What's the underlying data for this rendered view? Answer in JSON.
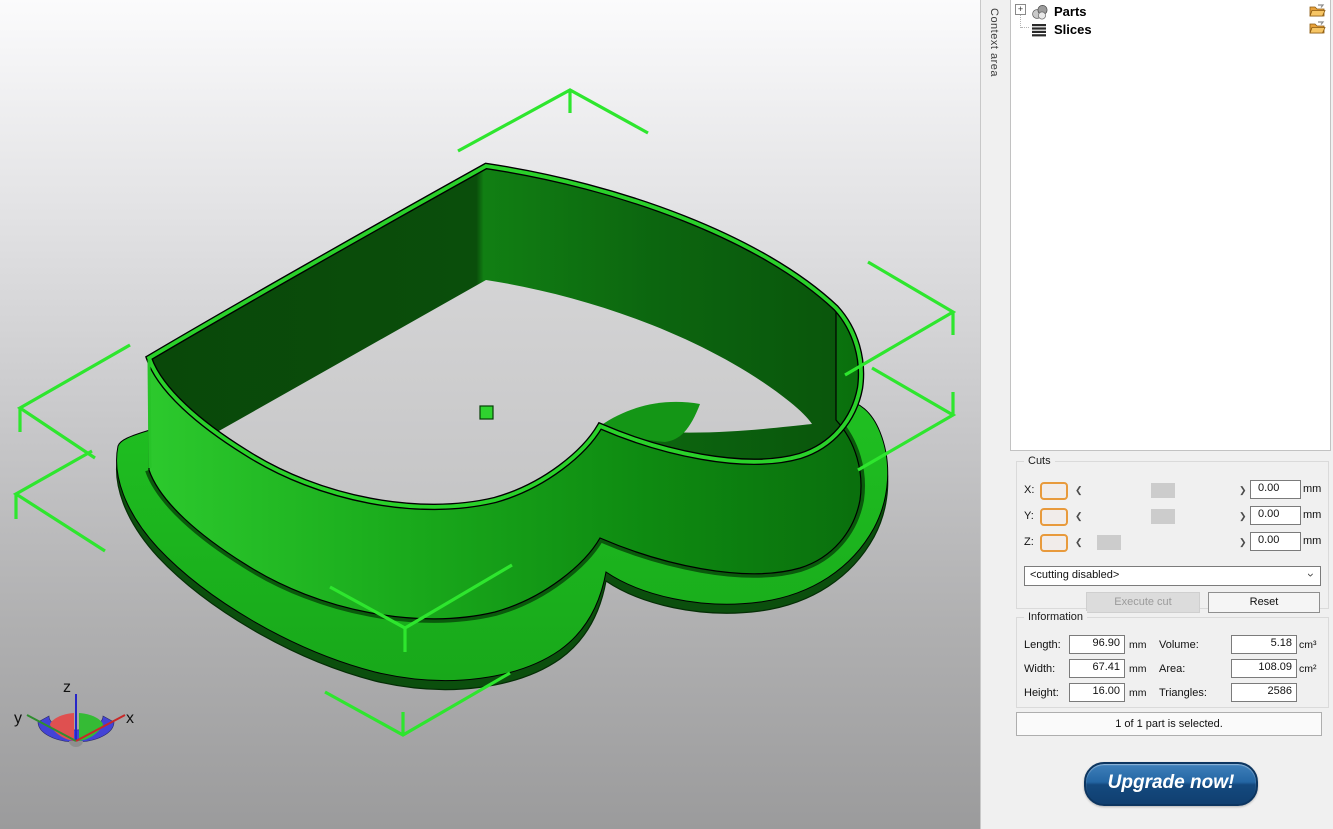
{
  "viewport": {
    "axes": {
      "x_label": "x",
      "y_label": "y",
      "z_label": "z"
    },
    "model": {
      "name": "heart-shaped cookie cutter",
      "color_bright": "#22cc24",
      "color_dark": "#0a4f0b",
      "selection_marker_color": "#2ee62e"
    }
  },
  "context_strip": {
    "label": "Context area"
  },
  "tree": {
    "items": [
      {
        "label": "Parts",
        "icon": "parts-spheres-icon",
        "expander": "+"
      },
      {
        "label": "Slices",
        "icon": "slices-stack-icon"
      }
    ]
  },
  "cuts": {
    "title": "Cuts",
    "rows": [
      {
        "axis": "X:",
        "value": "0.00",
        "unit": "mm"
      },
      {
        "axis": "Y:",
        "value": "0.00",
        "unit": "mm"
      },
      {
        "axis": "Z:",
        "value": "0.00",
        "unit": "mm"
      }
    ],
    "mode_dropdown": "<cutting disabled>",
    "execute_button": "Execute cut",
    "reset_button": "Reset"
  },
  "information": {
    "title": "Information",
    "fields": [
      {
        "label": "Length:",
        "value": "96.90",
        "unit": "mm"
      },
      {
        "label": "Width:",
        "value": "67.41",
        "unit": "mm"
      },
      {
        "label": "Height:",
        "value": "16.00",
        "unit": "mm"
      },
      {
        "label": "Volume:",
        "value": "5.18",
        "unit": "cm³"
      },
      {
        "label": "Area:",
        "value": "108.09",
        "unit": "cm²"
      },
      {
        "label": "Triangles:",
        "value": "2586",
        "unit": ""
      }
    ],
    "status": "1 of 1 part is selected."
  },
  "upgrade": {
    "label": "Upgrade now!",
    "color": "#14497e"
  }
}
